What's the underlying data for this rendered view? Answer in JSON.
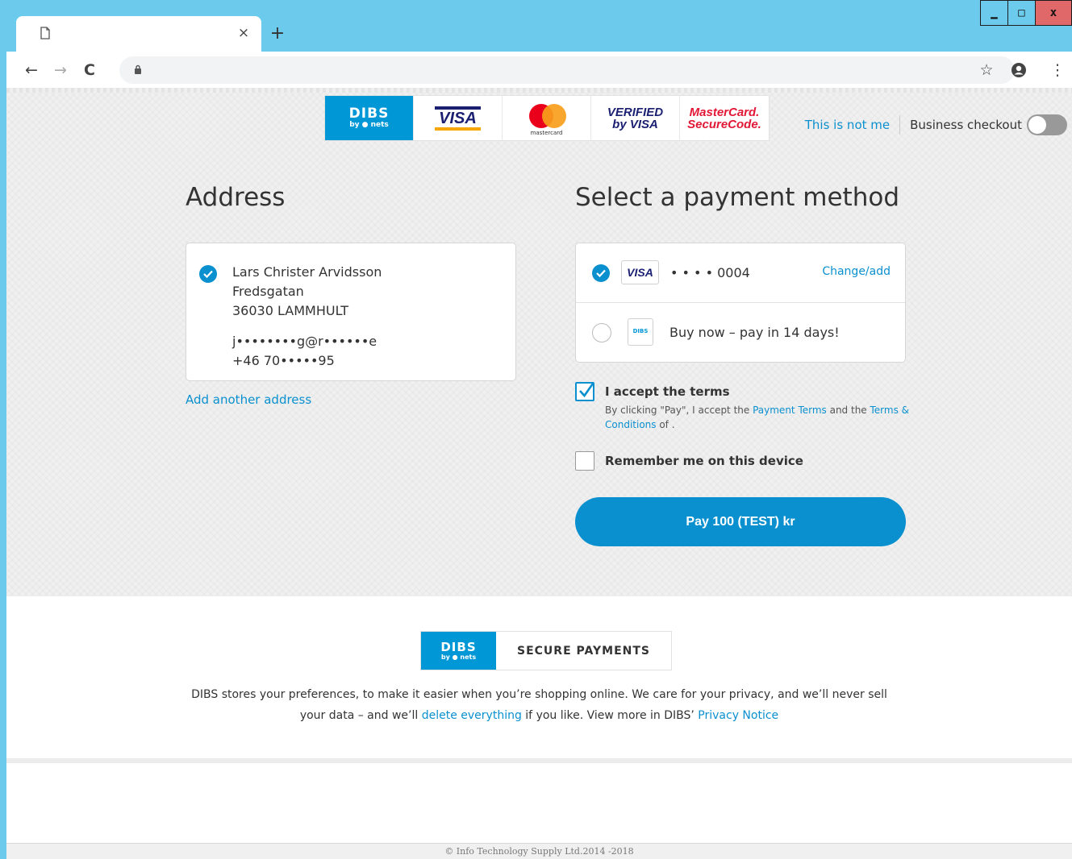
{
  "browser": {
    "tab_close": "×",
    "new_tab": "+",
    "win_minimize": "▁",
    "win_maximize": "□",
    "win_close": "x",
    "back": "←",
    "forward": "→",
    "reload": "C",
    "bookmark": "☆",
    "menu": "⋮",
    "icons": {
      "page": "page-icon",
      "lock": "lock-icon",
      "profile": "account-icon"
    }
  },
  "brands": {
    "dibs_big": "DIBS",
    "dibs_small": "by ● nets",
    "visa": "VISA",
    "mastercard": "mastercard",
    "verified_line1": "VERIFIED",
    "verified_line2": "by VISA",
    "securecode_line1": "MasterCard.",
    "securecode_line2": "SecureCode."
  },
  "header": {
    "not_me": "This is not me",
    "business_checkout": "Business checkout"
  },
  "address": {
    "title": "Address",
    "name": "Lars Christer Arvidsson",
    "street": "Fredsgatan",
    "city": "36030 LAMMHULT",
    "email": "j••••••••g@r••••••e",
    "phone": "+46 70•••••95",
    "add_another": "Add another address"
  },
  "payment": {
    "title": "Select a payment method",
    "card_brand": "VISA",
    "card_masked": "• • • • 0004",
    "change_add": "Change/add",
    "invoice_badge": "DIBS",
    "invoice_label": "Buy now – pay in 14 days!",
    "terms_title": "I accept the terms",
    "terms_pre": "By clicking \"Pay\", I accept the ",
    "terms_link1": "Payment Terms",
    "terms_mid": " and the ",
    "terms_link2": "Terms & Conditions",
    "terms_post": " of .",
    "remember": "Remember me on this device",
    "pay_button": "Pay 100 (TEST) kr"
  },
  "footer": {
    "secure_dibs": "DIBS",
    "secure_dibs_small": "by ● nets",
    "secure_label": "SECURE PAYMENTS",
    "privacy_1": "DIBS stores your preferences, to make it easier when you’re shopping online. We care for your privacy, and we’ll never sell",
    "privacy_2a": "your data – and we’ll ",
    "privacy_link1": "delete everything",
    "privacy_2b": " if you like. View more in DIBS’ ",
    "privacy_link2": "Privacy Notice",
    "copyright": "© Info Technology Supply Ltd.2014 -2018"
  },
  "colors": {
    "accent": "#0a90cf",
    "dibs": "#0097d6",
    "chrome": "#6ccbec"
  }
}
